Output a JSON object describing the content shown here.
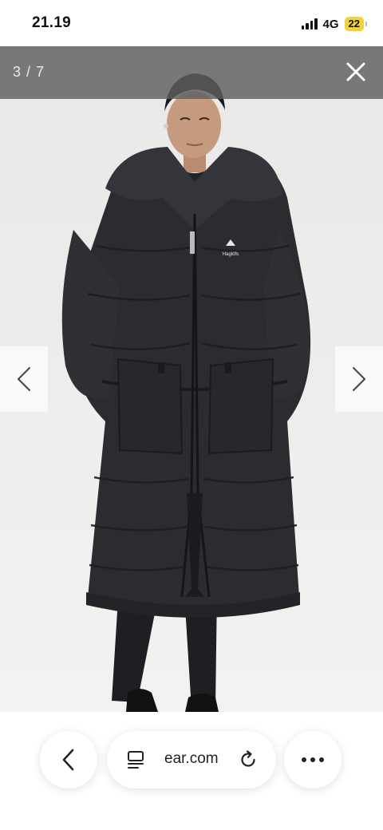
{
  "status_bar": {
    "time": "21.19",
    "network": "4G",
    "battery": "22"
  },
  "viewer": {
    "counter": "3 / 7",
    "close_icon": "close-icon",
    "prev_icon": "chevron-left-icon",
    "next_icon": "chevron-right-icon",
    "logo_text": "Haglöfs"
  },
  "browser_bar": {
    "url": "ear.com",
    "back_icon": "chevron-left-icon",
    "reader_icon": "reader-mode-icon",
    "reload_icon": "reload-icon",
    "more_icon": "more-horizontal-icon"
  },
  "colors": {
    "jacket": "#2b2c2f",
    "overlay_bar": "#5f5f5f",
    "battery": "#f2d23c"
  }
}
